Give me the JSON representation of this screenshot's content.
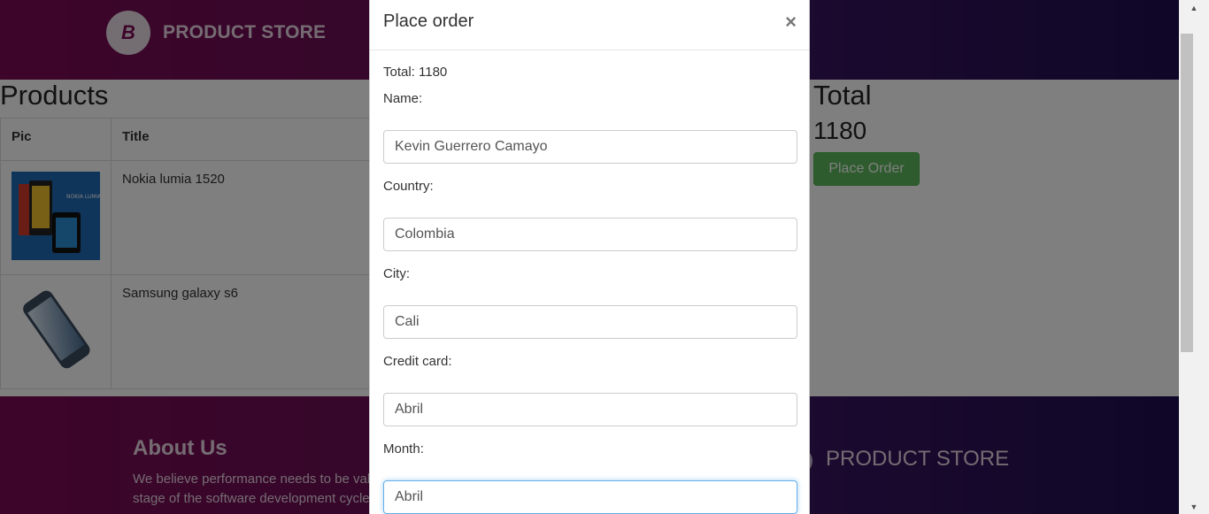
{
  "header": {
    "brand": "PRODUCT STORE",
    "logo_letter": "B"
  },
  "main": {
    "products_title": "Products",
    "columns": [
      "Pic",
      "Title"
    ],
    "rows": [
      {
        "title": "Nokia lumia 1520"
      },
      {
        "title": "Samsung galaxy s6"
      }
    ],
    "total_title": "Total",
    "total_value": "1180",
    "place_order_label": "Place Order"
  },
  "footer": {
    "about_title": "About Us",
    "about_text_line1": "We believe performance needs to be valic",
    "about_text_line2": "stage of the software development cycle a",
    "brand": "PRODUCT STORE"
  },
  "modal": {
    "title": "Place order",
    "close": "×",
    "total_line": "Total: 1180",
    "fields": [
      {
        "label": "Name:",
        "value": "Kevin Guerrero Camayo"
      },
      {
        "label": "Country:",
        "value": "Colombia"
      },
      {
        "label": "City:",
        "value": "Cali"
      },
      {
        "label": "Credit card:",
        "value": "Abril"
      },
      {
        "label": "Month:",
        "value": "Abril"
      }
    ]
  },
  "colors": {
    "header_gradient_start": "#7a0a52",
    "header_gradient_end": "#1f0f50",
    "success_button": "#5cb85c",
    "focus_border": "#66afe9"
  }
}
